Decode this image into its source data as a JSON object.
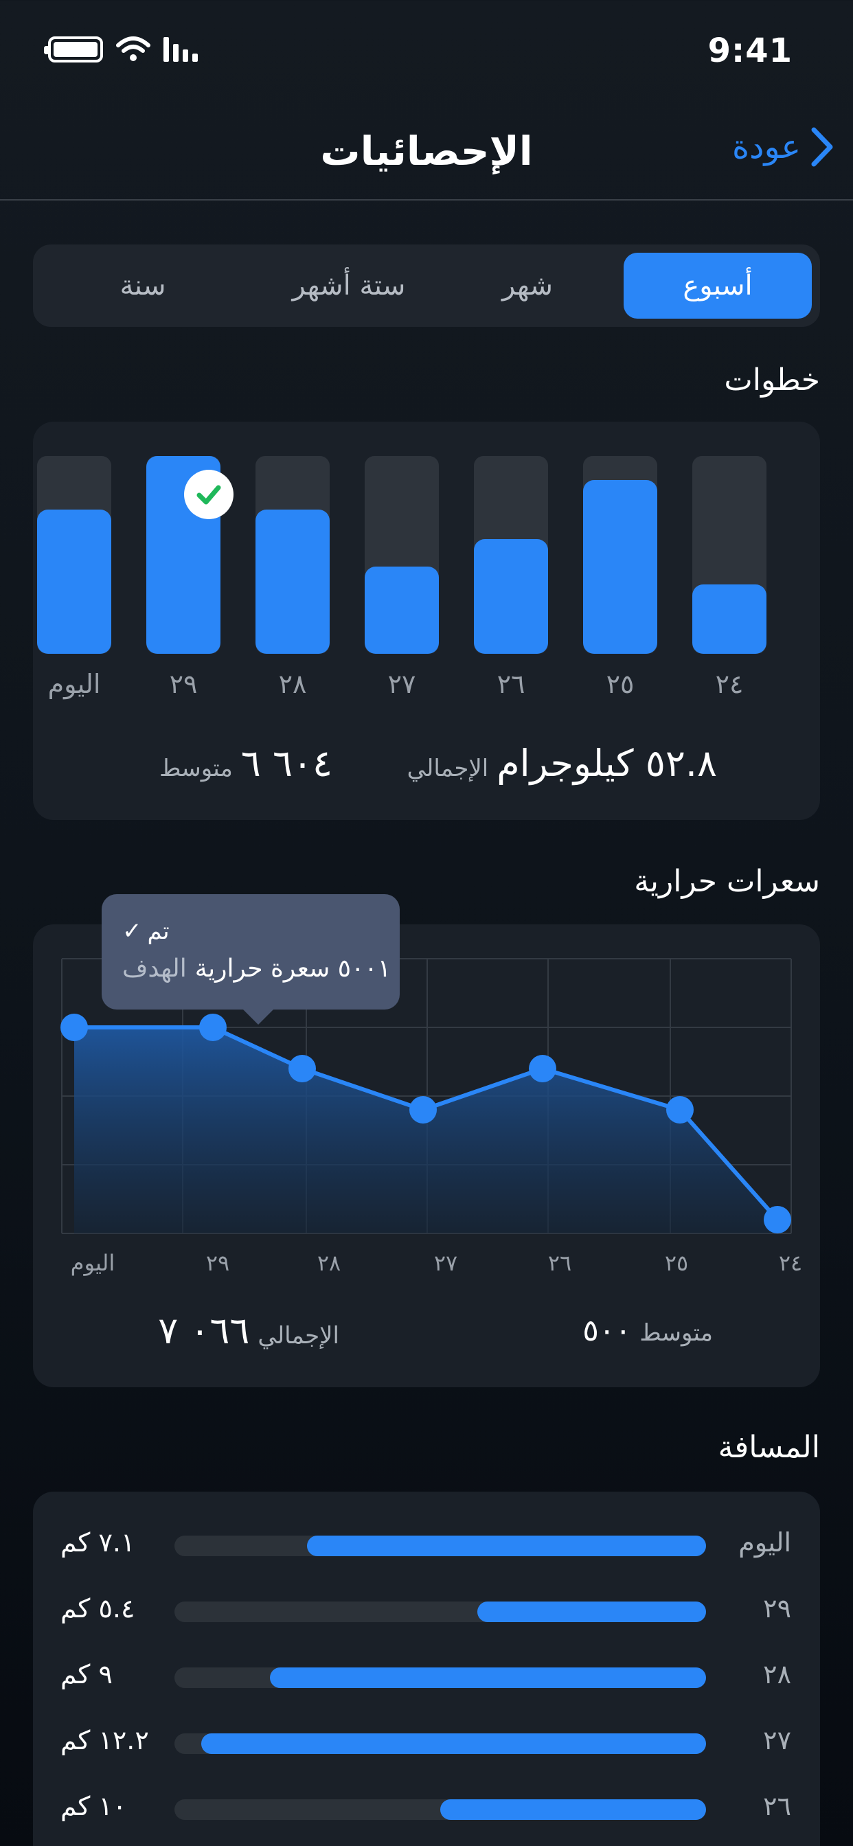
{
  "status_bar": {
    "time": "9:41"
  },
  "nav": {
    "title": "الإحصائيات",
    "back_label": "عودة"
  },
  "segments": [
    "أسبوع",
    "شهر",
    "ستة أشهر",
    "سنة"
  ],
  "steps": {
    "title": "خطوات",
    "days": [
      "٢٤",
      "٢٥",
      "٢٦",
      "٢٧",
      "٢٨",
      "٢٩",
      "اليوم"
    ],
    "fill_fraction": [
      0.35,
      0.88,
      0.58,
      0.44,
      0.73,
      1.0,
      0.73
    ],
    "goal_reached_day": "٢٩",
    "total_value": "٥٢.٨ كيلوجرام",
    "total_label": "الإجمالي",
    "avg_value": "٦٠٤ ٦",
    "avg_label": "متوسط"
  },
  "calories": {
    "title": "سعرات حرارية",
    "tooltip_status": "تم",
    "tooltip_value": "٥٠٠١ سعرة حرارية",
    "tooltip_label": "الهدف",
    "days": [
      "٢٤",
      "٢٥",
      "٢٦",
      "٢٧",
      "٢٨",
      "٢٩",
      "اليوم"
    ],
    "avg_label": "متوسط",
    "avg_value": "٥٠٠",
    "total_label": "الإجمالي",
    "total_value": "٠٦٦ ٧"
  },
  "chart_data": {
    "type": "area",
    "x": [
      "٢٤",
      "٢٥",
      "٢٦",
      "٢٧",
      "٢٨",
      "٢٩",
      "اليوم"
    ],
    "series": [
      {
        "values": [
          0.2,
          1.8,
          2.4,
          1.8,
          2.4,
          3.0,
          3.0
        ]
      }
    ],
    "ylim": [
      0,
      4
    ],
    "grid": true
  },
  "distance": {
    "title": "المسافة",
    "rows": [
      {
        "day": "اليوم",
        "value": "٧.١ كم",
        "fraction": 0.75
      },
      {
        "day": "٢٩",
        "value": "٥.٤ كم",
        "fraction": 0.43
      },
      {
        "day": "٢٨",
        "value": "٩ كم",
        "fraction": 0.82
      },
      {
        "day": "٢٧",
        "value": "١٢.٢ كم",
        "fraction": 0.95
      },
      {
        "day": "٢٦",
        "value": "١٠ كم",
        "fraction": 0.5
      }
    ]
  },
  "colors": {
    "accent": "#2a86f7",
    "success": "#1fb85a",
    "background": "#111820",
    "card": "#1a2028"
  }
}
